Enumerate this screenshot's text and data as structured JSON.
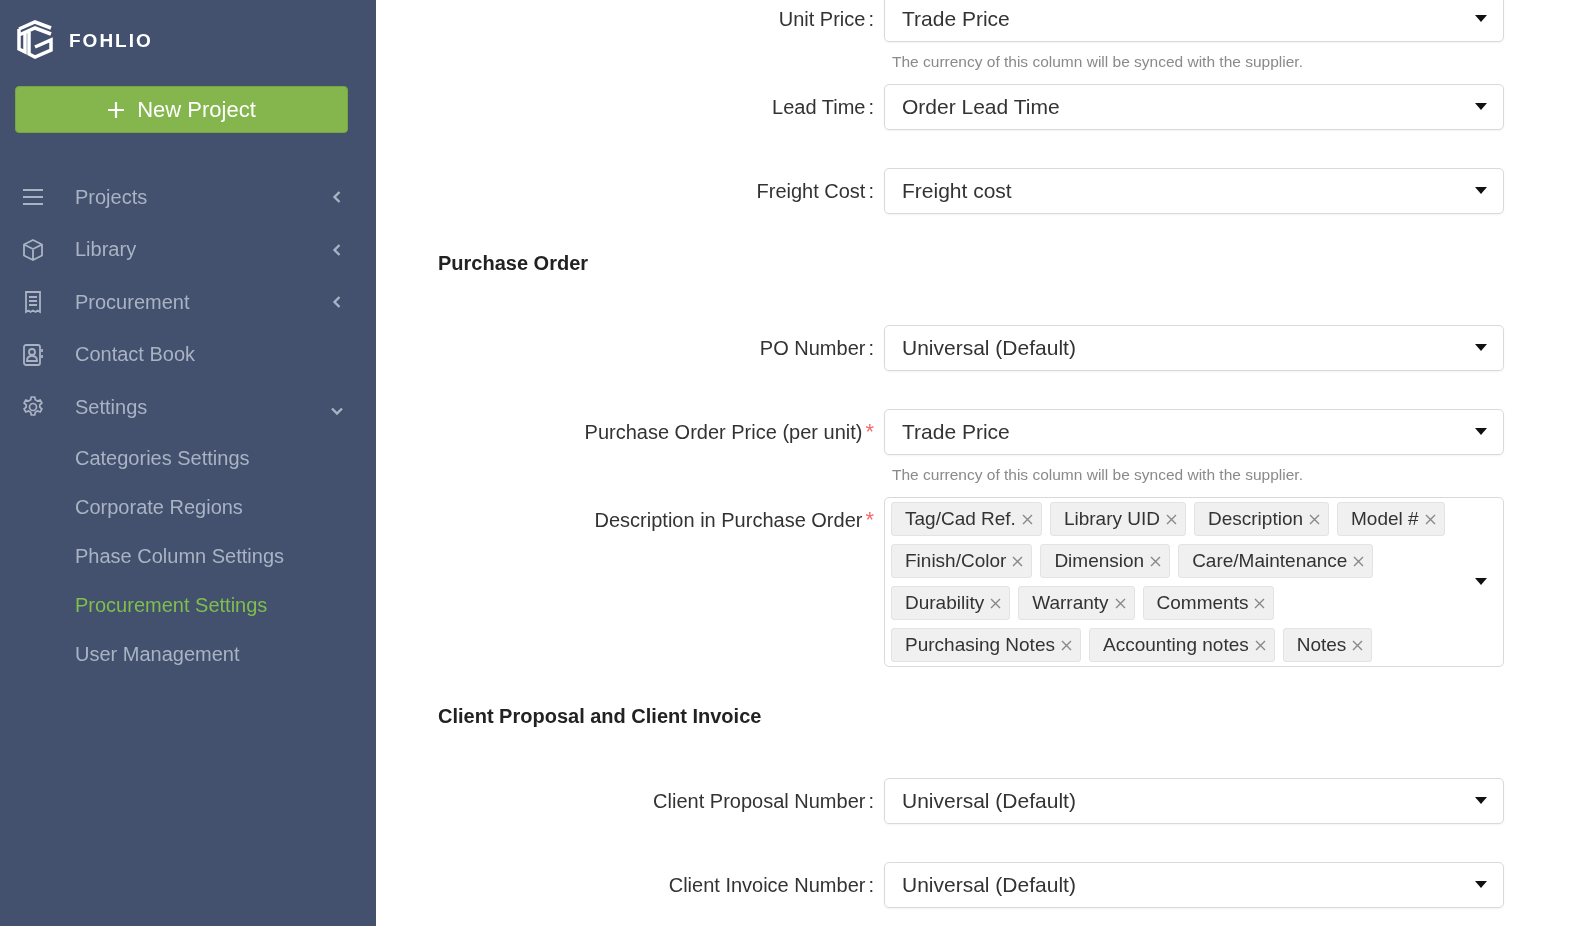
{
  "sidebar": {
    "brand": "FOHLIO",
    "new_project": "New Project",
    "nav": [
      {
        "label": "Projects",
        "expanded": false
      },
      {
        "label": "Library",
        "expanded": false
      },
      {
        "label": "Procurement",
        "expanded": false
      },
      {
        "label": "Contact Book"
      },
      {
        "label": "Settings",
        "expanded": true,
        "children": [
          {
            "label": "Categories Settings",
            "selected": false
          },
          {
            "label": "Corporate Regions",
            "selected": false
          },
          {
            "label": "Phase Column Settings",
            "selected": false
          },
          {
            "label": "Procurement Settings",
            "selected": true
          },
          {
            "label": "User Management",
            "selected": false
          }
        ]
      }
    ]
  },
  "form": [
    {
      "kind": "select",
      "label": "Unit Price",
      "colon": ":",
      "value": "Trade Price",
      "hint": "The currency of this column will be synced with the supplier."
    },
    {
      "kind": "select",
      "label": "Lead Time",
      "colon": ":",
      "value": "Order Lead Time"
    },
    {
      "kind": "select",
      "label": "Freight Cost",
      "colon": ":",
      "value": "Freight cost"
    },
    {
      "kind": "heading",
      "label": "Purchase Order"
    },
    {
      "kind": "select",
      "label": "PO Number",
      "colon": ":",
      "value": "Universal (Default)"
    },
    {
      "kind": "select",
      "label": "Purchase Order Price (per unit)",
      "required_mark": "*",
      "value": "Trade Price",
      "hint": "The currency of this column will be synced with the supplier."
    },
    {
      "kind": "tags",
      "label": "Description in Purchase Order",
      "required_mark": "*",
      "tags": [
        "Tag/Cad Ref.",
        "Library UID",
        "Description",
        "Model #",
        "Finish/Color",
        "Dimension",
        "Care/Maintenance",
        "Durability",
        "Warranty",
        "Comments",
        "Purchasing Notes",
        "Accounting notes",
        "Notes"
      ]
    },
    {
      "kind": "heading",
      "label": "Client Proposal and Client Invoice"
    },
    {
      "kind": "select",
      "label": "Client Proposal Number",
      "colon": ":",
      "value": "Universal (Default)"
    },
    {
      "kind": "select",
      "label": "Client Invoice Number",
      "colon": ":",
      "value": "Universal (Default)"
    }
  ]
}
